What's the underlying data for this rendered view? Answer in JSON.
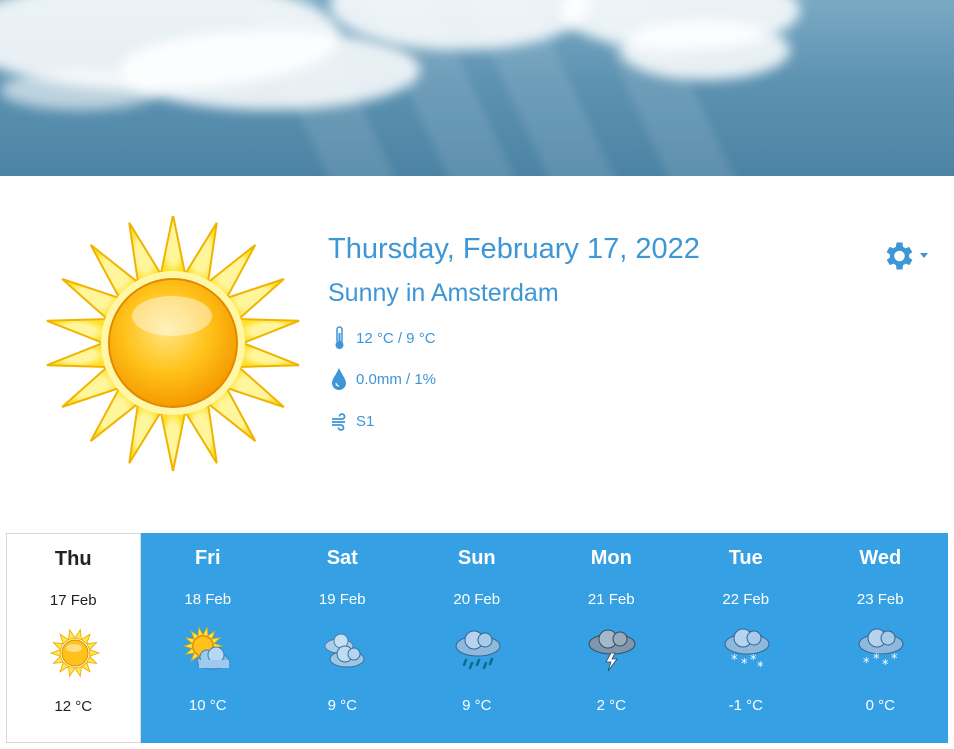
{
  "today": {
    "date": "Thursday, February 17, 2022",
    "condition": "Sunny in Amsterdam",
    "temperature": "12 °C / 9 °C",
    "precipitation": "0.0mm / 1%",
    "wind": "S1",
    "icon": "sun-icon"
  },
  "forecast": [
    {
      "day": "Thu",
      "date": "17 Feb",
      "temp": "12 °C",
      "icon": "sunny-icon",
      "selected": true
    },
    {
      "day": "Fri",
      "date": "18 Feb",
      "temp": "10 °C",
      "icon": "partly-cloudy-icon"
    },
    {
      "day": "Sat",
      "date": "19 Feb",
      "temp": "9 °C",
      "icon": "cloudy-icon"
    },
    {
      "day": "Sun",
      "date": "20 Feb",
      "temp": "9 °C",
      "icon": "rain-icon"
    },
    {
      "day": "Mon",
      "date": "21 Feb",
      "temp": "2 °C",
      "icon": "thunderstorm-icon"
    },
    {
      "day": "Tue",
      "date": "22 Feb",
      "temp": "-1 °C",
      "icon": "snow-icon"
    },
    {
      "day": "Wed",
      "date": "23 Feb",
      "temp": "0 °C",
      "icon": "snow-icon"
    }
  ],
  "colors": {
    "accent": "#3d96d6",
    "forecast_bg": "#35a0e3",
    "sun_yellow": "#ffd21f",
    "sun_orange": "#f5a400"
  }
}
